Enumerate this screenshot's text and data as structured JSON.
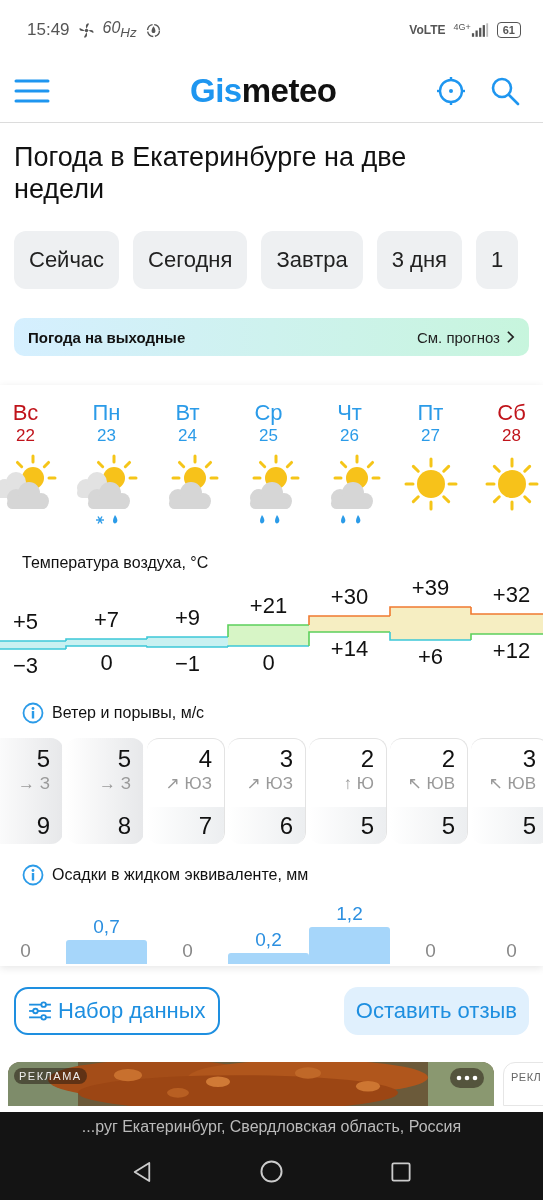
{
  "status_bar": {
    "time": "15:49",
    "refresh": "60$_{Hz}$",
    "network": "VoLTE",
    "generation": "4G+",
    "battery": "61"
  },
  "header": {
    "logo_accent": "Gis",
    "logo_rest": "meteo"
  },
  "title": "Погода в Екатеринбурге на две недели",
  "tabs": [
    {
      "label": "Сейчас",
      "selected": false
    },
    {
      "label": "Сегодня",
      "selected": false
    },
    {
      "label": "Завтра",
      "selected": false
    },
    {
      "label": "3 дня",
      "selected": false
    },
    {
      "label": "1",
      "selected": false
    }
  ],
  "weekend_banner": {
    "label": "Погода на выходные",
    "link": "См. прогноз"
  },
  "days": [
    {
      "name": "Вс",
      "date": "22",
      "weekend": true,
      "kind": "clouds",
      "max": "+5",
      "min": "−3"
    },
    {
      "name": "Пн",
      "date": "23",
      "weekend": false,
      "kind": "sleet",
      "max": "+7",
      "min": "0"
    },
    {
      "name": "Вт",
      "date": "24",
      "weekend": false,
      "kind": "cloud",
      "max": "+9",
      "min": "−1"
    },
    {
      "name": "Ср",
      "date": "25",
      "weekend": false,
      "kind": "rain",
      "max": "+21",
      "min": "0"
    },
    {
      "name": "Чт",
      "date": "26",
      "weekend": false,
      "kind": "rain",
      "max": "+30",
      "min": "+14"
    },
    {
      "name": "Пт",
      "date": "27",
      "weekend": false,
      "kind": "sun",
      "max": "+39",
      "min": "+6"
    },
    {
      "name": "Сб",
      "date": "28",
      "weekend": true,
      "kind": "sun",
      "max": "+32",
      "min": "+12"
    }
  ],
  "temperature_title": "Температура воздуха, °C",
  "wind_title": "Ветер и порывы, м/с",
  "wind": [
    {
      "speed": "5",
      "direction": "→ З",
      "gust": "9",
      "highlighted": true
    },
    {
      "speed": "5",
      "direction": "→ З",
      "gust": "8",
      "highlighted": true
    },
    {
      "speed": "4",
      "direction": "↗ ЮЗ",
      "gust": "7",
      "highlighted": false
    },
    {
      "speed": "3",
      "direction": "↗ ЮЗ",
      "gust": "6",
      "highlighted": false
    },
    {
      "speed": "2",
      "direction": "↑ Ю",
      "gust": "5",
      "highlighted": false
    },
    {
      "speed": "2",
      "direction": "↖ ЮВ",
      "gust": "5",
      "highlighted": false
    },
    {
      "speed": "3",
      "direction": "↖ ЮВ",
      "gust": "5",
      "highlighted": false
    }
  ],
  "precipitation_title": "Осадки в жидком эквиваленте, мм",
  "precipitation": [
    {
      "value": "0"
    },
    {
      "value": "0,7"
    },
    {
      "value": "0"
    },
    {
      "value": "0,2"
    },
    {
      "value": "1,2"
    },
    {
      "value": "0"
    },
    {
      "value": "0"
    }
  ],
  "buttons": {
    "dataset": "Набор данных",
    "feedback": "Оставить отзыв"
  },
  "ads": [
    {
      "kind": "picture",
      "label": "РЕКЛАМА"
    },
    {
      "kind": "blank",
      "label": "РЕКЛ"
    }
  ],
  "location_bar": "...руг Екатеринбург, Свердловская область, Россия"
}
